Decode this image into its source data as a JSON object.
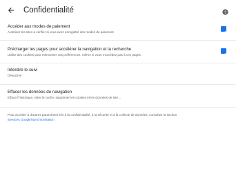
{
  "header": {
    "title": "Confidentialité",
    "back_icon": "arrow-left-icon",
    "help_icon": "help-circle-icon"
  },
  "settings": [
    {
      "title": "Accéder aux modes de paiement",
      "subtitle": "Autoriser les sites à vérifier si vous avez enregistré des modes de paiement",
      "checked": true
    },
    {
      "title": "Précharger les pages pour accélérer la navigation et la recherche",
      "subtitle": "Utilise des cookies pour mémoriser vos préférences, même si vous n'accédez pas à ces pages",
      "checked": true
    },
    {
      "title": "Interdire le suivi",
      "subtitle": "Désactivé"
    },
    {
      "title": "Effacer les données de navigation",
      "subtitle": "Efface l'historique, vider le cache, supprimer les cookies et les données de site…"
    }
  ],
  "footer": {
    "text": "Pour accéder à d'autres paramètres liés à la confidentialité, à la sécurité et à la collecte de données, consultez la section",
    "link": "Services Google/Synchronisation"
  },
  "colors": {
    "accent": "#1a73e8",
    "text_primary": "#202124",
    "text_secondary": "#5f6368"
  }
}
